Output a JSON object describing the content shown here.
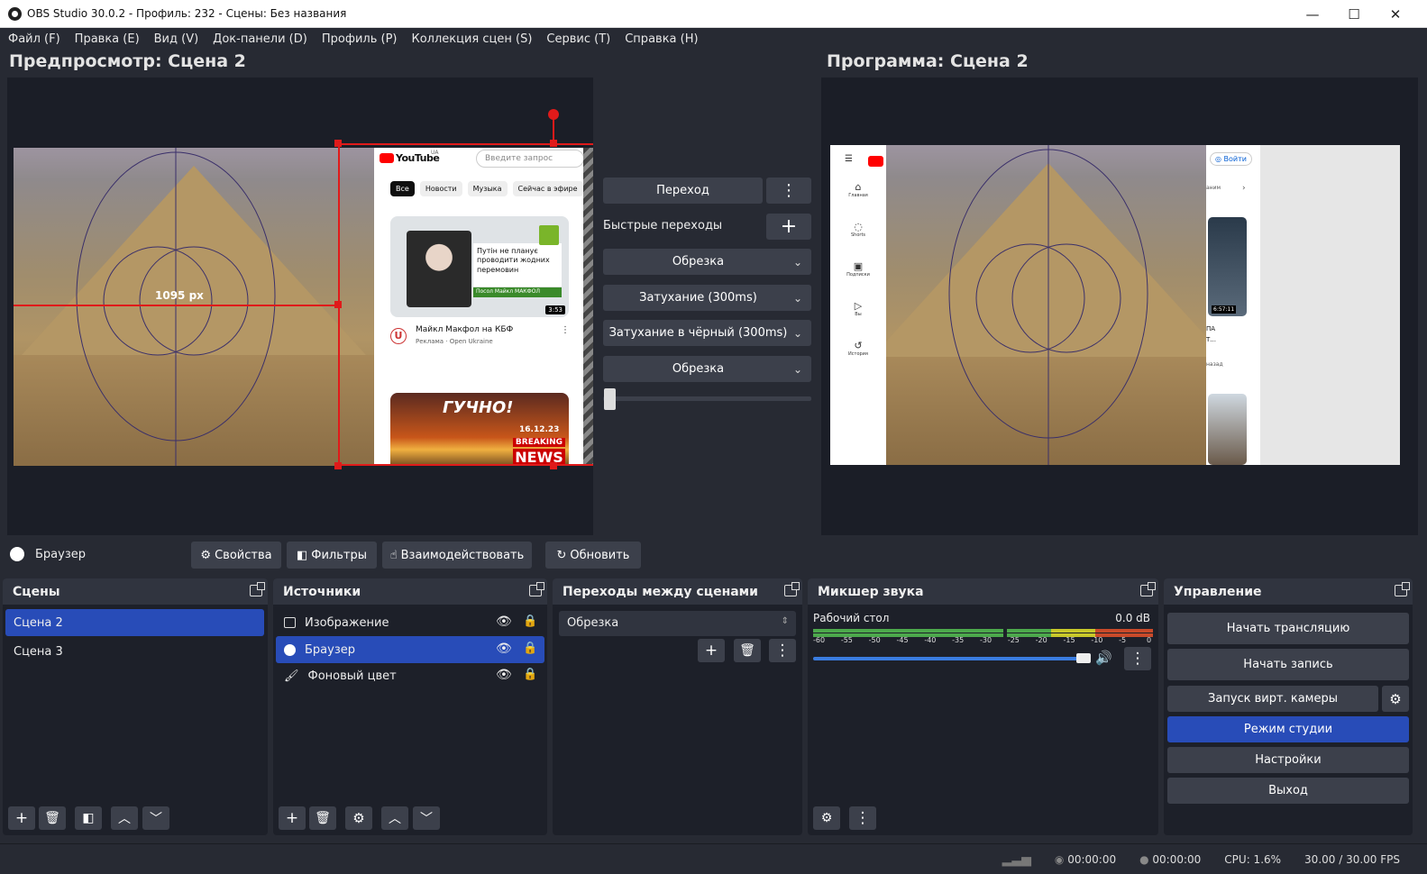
{
  "window": {
    "title": "OBS Studio 30.0.2 - Профиль: 232 - Сцены: Без названия"
  },
  "menu": [
    "Файл (F)",
    "Правка (E)",
    "Вид (V)",
    "Док-панели (D)",
    "Профиль (P)",
    "Коллекция сцен (S)",
    "Сервис (T)",
    "Справка (H)"
  ],
  "preview": {
    "title": "Предпросмотр: Сцена 2",
    "measure_label": "1095 px"
  },
  "program": {
    "title": "Программа: Сцена 2"
  },
  "youtube": {
    "logo": "YouTube",
    "country": "UA",
    "search_placeholder": "Введите запрос",
    "chips": [
      "Все",
      "Новости",
      "Музыка",
      "Сейчас в эфире"
    ],
    "card1": {
      "headline": "Путін не планує проводити жодних перемовин",
      "duration": "3:53",
      "source": "Посол Майкл МАКФОЛ",
      "title": "Майкл Макфол на КБФ",
      "meta": "Реклама · Open Ukraine",
      "channel_letter": "U"
    },
    "card2": {
      "headline": "ГУЧНО!",
      "date": "16.12.23",
      "tag1": "BREAKING",
      "tag2": "NEWS"
    },
    "program_side": {
      "login": "Войти",
      "duration": "6:57:11",
      "nav": [
        "Главная",
        "Shorts",
        "Подписки",
        "Вы",
        "История"
      ],
      "snip1": "ПА",
      "snip2": "Т...",
      "snip3": "назад",
      "snip4": "аним"
    }
  },
  "transitions_mid": {
    "transition_btn": "Переход",
    "quick_label": "Быстрые переходы",
    "items": [
      "Обрезка",
      "Затухание (300ms)",
      "Затухание в чёрный (300ms)",
      "Обрезка"
    ]
  },
  "source_toolbar": {
    "selected_source": "Браузер",
    "properties": "Свойства",
    "filters": "Фильтры",
    "interact": "Взаимодействовать",
    "refresh": "Обновить"
  },
  "scenes": {
    "title": "Сцены",
    "items": [
      "Сцена 2",
      "Сцена 3"
    ]
  },
  "sources": {
    "title": "Источники",
    "items": [
      "Изображение",
      "Браузер",
      "Фоновый цвет"
    ]
  },
  "scene_transitions": {
    "title": "Переходы между сценами",
    "selected": "Обрезка"
  },
  "mixer": {
    "title": "Микшер звука",
    "channel": "Рабочий стол",
    "db": "0.0 dB",
    "ticks": [
      "-60",
      "-55",
      "-50",
      "-45",
      "-40",
      "-35",
      "-30",
      "-25",
      "-20",
      "-15",
      "-10",
      "-5",
      "0"
    ],
    "volume": 1.0
  },
  "controls": {
    "title": "Управление",
    "buttons": [
      "Начать трансляцию",
      "Начать запись",
      "Запуск вирт. камеры",
      "Режим студии",
      "Настройки",
      "Выход"
    ]
  },
  "status": {
    "stream_time": "00:00:00",
    "rec_time": "00:00:00",
    "cpu": "CPU: 1.6%",
    "fps": "30.00 / 30.00 FPS"
  },
  "colors": {
    "accent": "#284cb8",
    "bg": "#272a33",
    "panel": "#1d2029",
    "button": "#3c404b",
    "select_red": "#e01a1a"
  }
}
